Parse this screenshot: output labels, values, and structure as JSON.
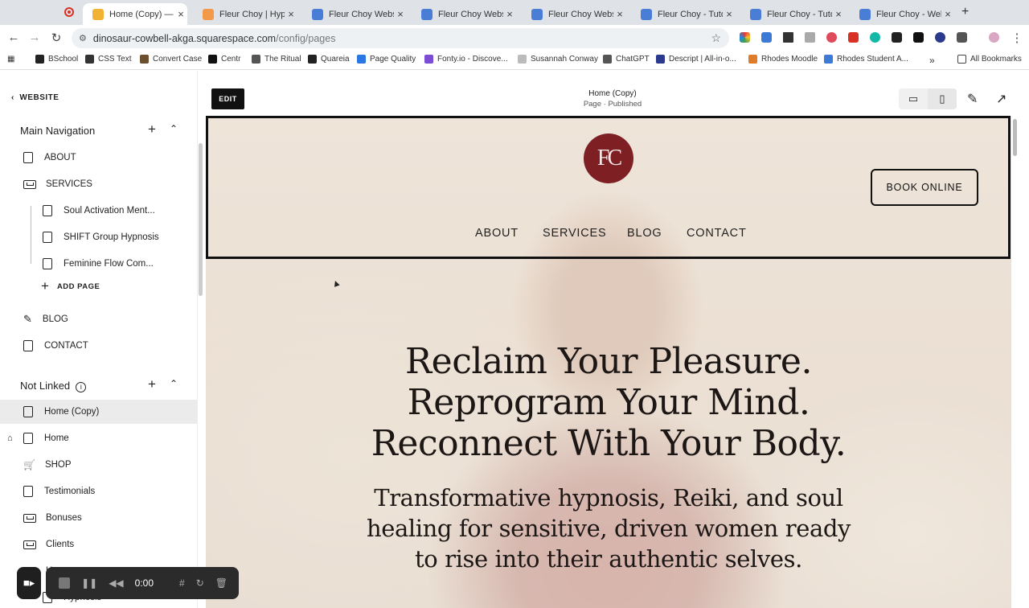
{
  "tabs": [
    {
      "title": "Home (Copy) — Re",
      "active": true,
      "color": "#f2b233"
    },
    {
      "title": "Fleur Choy | Hypno",
      "active": false,
      "color": "#f2994a"
    },
    {
      "title": "Fleur Choy Website",
      "active": false,
      "color": "#4a7dd6"
    },
    {
      "title": "Fleur Choy Website",
      "active": false,
      "color": "#4a7dd6"
    },
    {
      "title": "Fleur Choy Website",
      "active": false,
      "color": "#4a7dd6"
    },
    {
      "title": "Fleur Choy - Tutoria",
      "active": false,
      "color": "#4a7dd6"
    },
    {
      "title": "Fleur Choy - Tutoria",
      "active": false,
      "color": "#4a7dd6"
    },
    {
      "title": "Fleur Choy - Websi",
      "active": false,
      "color": "#4a7dd6"
    }
  ],
  "address": {
    "host": "dinosaur-cowbell-akga.squarespace.com",
    "path": "/config/pages"
  },
  "bookmarks": [
    "BSchool",
    "CSS Text",
    "Convert Case",
    "Centr",
    "The Ritual",
    "Quareia",
    "Page Quality",
    "Fonty.io - Discove...",
    "Susannah Conway",
    "ChatGPT",
    "Descript | All-in-o...",
    "Rhodes Moodle",
    "Rhodes Student A..."
  ],
  "bookmarks_all": "All Bookmarks",
  "sidebar": {
    "back_label": "WEBSITE",
    "main_nav_label": "Main Navigation",
    "main_nav": [
      {
        "label": "ABOUT",
        "kind": "page"
      },
      {
        "label": "SERVICES",
        "kind": "folder"
      },
      {
        "label": "Soul Activation Ment...",
        "kind": "page",
        "child": true
      },
      {
        "label": "SHIFT Group Hypnosis",
        "kind": "page",
        "child": true
      },
      {
        "label": "Feminine Flow Com...",
        "kind": "page",
        "child": true
      },
      {
        "label": "ADD PAGE",
        "kind": "add",
        "child": true
      },
      {
        "label": "BLOG",
        "kind": "blog"
      },
      {
        "label": "CONTACT",
        "kind": "page"
      }
    ],
    "not_linked_label": "Not Linked",
    "not_linked": [
      {
        "label": "Home (Copy)",
        "kind": "page",
        "selected": true
      },
      {
        "label": "Home",
        "kind": "page",
        "home": true
      },
      {
        "label": "SHOP",
        "kind": "shop"
      },
      {
        "label": "Testimonials",
        "kind": "page"
      },
      {
        "label": "Bonuses",
        "kind": "folder"
      },
      {
        "label": "Clients",
        "kind": "folder"
      },
      {
        "label": "Hyp",
        "kind": "folder"
      },
      {
        "label": "Hypnosis",
        "kind": "page",
        "child": true
      }
    ]
  },
  "editor": {
    "edit_label": "EDIT",
    "page_title": "Home (Copy)",
    "page_status": "Page · Published"
  },
  "site": {
    "logo_text": "FC",
    "book_label": "BOOK ONLINE",
    "nav": [
      "ABOUT",
      "SERVICES",
      "BLOG",
      "CONTACT"
    ],
    "headline": [
      "Reclaim Your Pleasure.",
      "Reprogram Your Mind.",
      "Reconnect With Your Body."
    ],
    "subhead": [
      "Transformative hypnosis, Reiki, and soul",
      "healing for sensitive, driven women ready",
      "to rise into their authentic selves."
    ],
    "brand_color": "#7e1f24"
  },
  "recorder": {
    "time": "0:00"
  }
}
